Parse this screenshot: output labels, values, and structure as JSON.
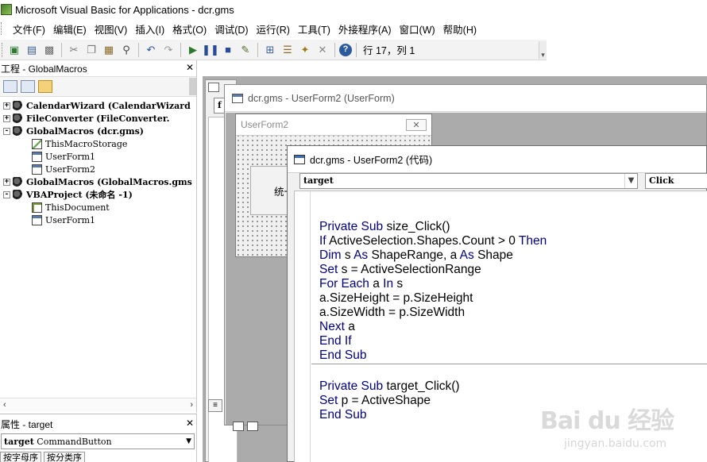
{
  "window": {
    "title": "Microsoft Visual Basic for Applications - dcr.gms"
  },
  "menubar": {
    "items": [
      "文件(F)",
      "编辑(E)",
      "视图(V)",
      "插入(I)",
      "格式(O)",
      "调试(D)",
      "运行(R)",
      "工具(T)",
      "外接程序(A)",
      "窗口(W)",
      "帮助(H)"
    ]
  },
  "toolbar": {
    "position": "行 17，列 1",
    "icons": [
      "vba-host-icon",
      "insert-userform-icon",
      "save-icon",
      "cut-icon",
      "copy-icon",
      "paste-icon",
      "find-icon",
      "undo-icon",
      "redo-icon",
      "run-icon",
      "break-icon",
      "reset-icon",
      "design-mode-icon",
      "project-explorer-icon",
      "properties-icon",
      "object-browser-icon",
      "toolbox-icon",
      "help-icon"
    ]
  },
  "project_pane": {
    "title": "工程 - GlobalMacros",
    "tree": [
      {
        "label": "CalendarWizard (CalendarWizard",
        "bold": true,
        "level": 0,
        "expander": "+",
        "icon": "project"
      },
      {
        "label": "FileConverter (FileConverter.",
        "bold": true,
        "level": 0,
        "expander": "+",
        "icon": "project"
      },
      {
        "label": "GlobalMacros (dcr.gms)",
        "bold": true,
        "level": 0,
        "expander": "-",
        "icon": "project"
      },
      {
        "label": "ThisMacroStorage",
        "bold": false,
        "level": 1,
        "expander": "",
        "icon": "module"
      },
      {
        "label": "UserForm1",
        "bold": false,
        "level": 1,
        "expander": "",
        "icon": "form"
      },
      {
        "label": "UserForm2",
        "bold": false,
        "level": 1,
        "expander": "",
        "icon": "form"
      },
      {
        "label": "GlobalMacros (GlobalMacros.gms",
        "bold": true,
        "level": 0,
        "expander": "+",
        "icon": "project"
      },
      {
        "label": "VBAProject (未命名 -1)",
        "bold": true,
        "level": 0,
        "expander": "-",
        "icon": "project"
      },
      {
        "label": "ThisDocument",
        "bold": false,
        "level": 1,
        "expander": "",
        "icon": "doc"
      },
      {
        "label": "UserForm1",
        "bold": false,
        "level": 1,
        "expander": "",
        "icon": "form"
      }
    ]
  },
  "properties_pane": {
    "title": "属性 - target",
    "object_name": "target",
    "object_type": "CommandButton",
    "tabs": [
      "按字母序",
      "按分类序"
    ]
  },
  "back_code_window": {
    "combo_text": "f"
  },
  "designer_window": {
    "title": "dcr.gms - UserForm2 (UserForm)",
    "form_caption": "UserForm2",
    "form_close": "✕",
    "button_text": "统一"
  },
  "code_window": {
    "title": "dcr.gms - UserForm2 (代码)",
    "object_combo": "target",
    "procedure_combo": "Click",
    "proc1_lines": [
      [
        [
          "kw",
          "Private Sub "
        ],
        [
          "tx",
          "size_Click()"
        ]
      ],
      [
        [
          "kw",
          "If "
        ],
        [
          "tx",
          "ActiveSelection.Shapes.Count > 0 "
        ],
        [
          "kw",
          "Then"
        ]
      ],
      [
        [
          "kw",
          "Dim "
        ],
        [
          "tx",
          "s "
        ],
        [
          "kw",
          "As "
        ],
        [
          "tx",
          "ShapeRange, a "
        ],
        [
          "kw",
          "As "
        ],
        [
          "tx",
          "Shape"
        ]
      ],
      [
        [
          "kw",
          "Set "
        ],
        [
          "tx",
          "s = ActiveSelectionRange"
        ]
      ],
      [
        [
          "kw",
          "For Each "
        ],
        [
          "tx",
          "a "
        ],
        [
          "kw",
          "In "
        ],
        [
          "tx",
          "s"
        ]
      ],
      [
        [
          "tx",
          "a.SizeHeight = p.SizeHeight"
        ]
      ],
      [
        [
          "tx",
          "a.SizeWidth = p.SizeWidth"
        ]
      ],
      [
        [
          "kw",
          "Next "
        ],
        [
          "tx",
          "a"
        ]
      ],
      [
        [
          "kw",
          "End If"
        ]
      ],
      [
        [
          "kw",
          "End Sub"
        ]
      ]
    ],
    "proc2_lines": [
      [
        [
          "kw",
          "Private Sub "
        ],
        [
          "tx",
          "target_Click()"
        ]
      ],
      [
        [
          "kw",
          "Set "
        ],
        [
          "tx",
          "p = ActiveShape"
        ]
      ],
      [
        [
          "kw",
          "End Sub"
        ]
      ]
    ]
  },
  "watermark": {
    "brand": "Bai du 经验",
    "url": "jingyan.baidu.com"
  },
  "colors": {
    "keyword": "#000080",
    "mdi_background": "#ababab",
    "pane_background": "#ffffff"
  }
}
